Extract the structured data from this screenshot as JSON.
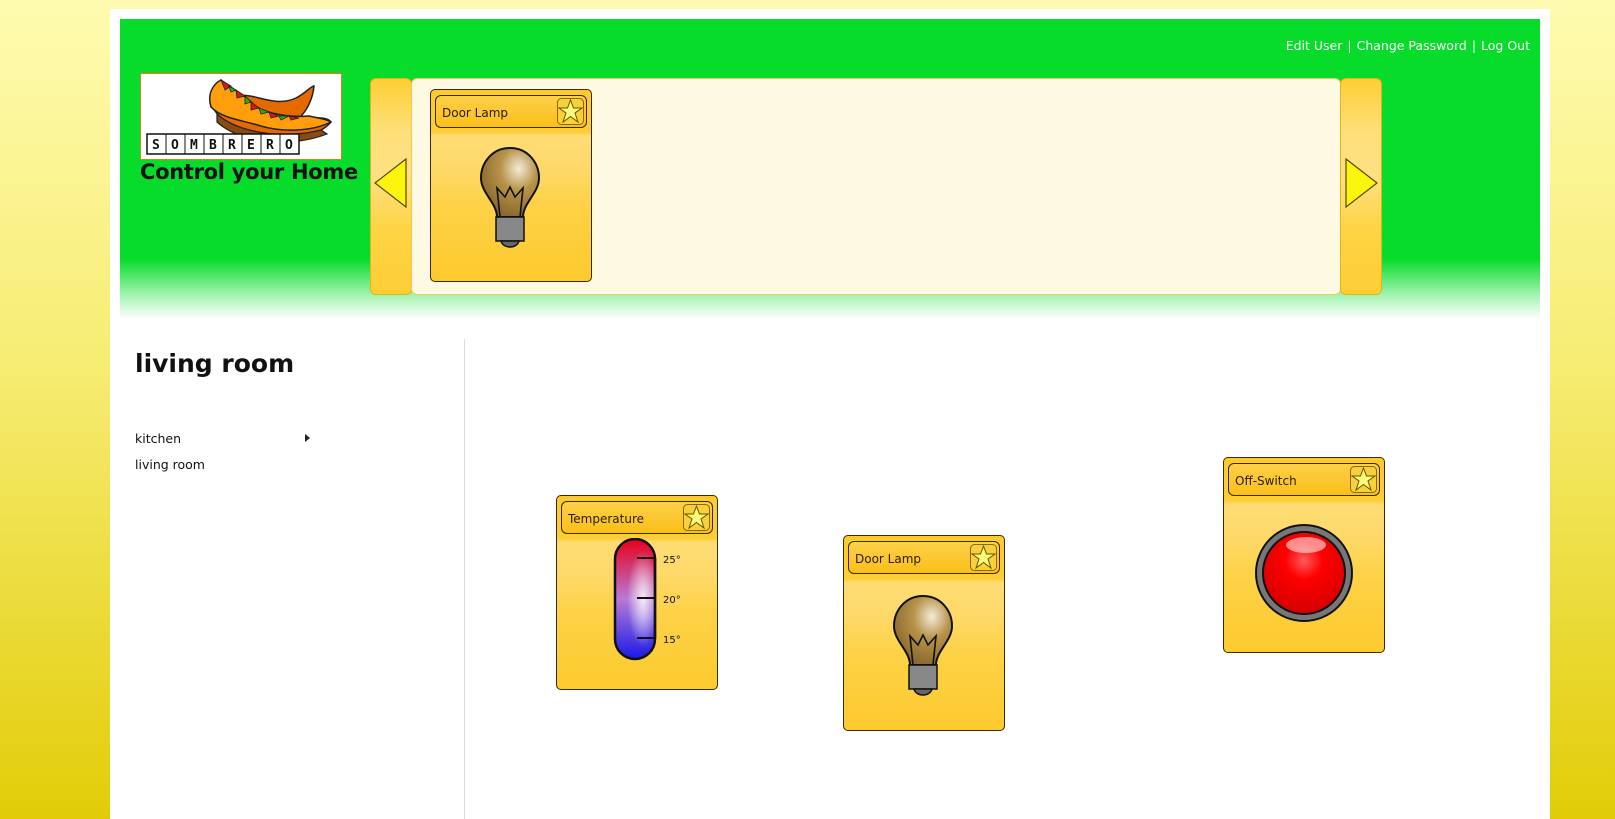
{
  "header": {
    "links": [
      "Edit User",
      "Change Password",
      "Log Out"
    ],
    "logo_text": "SOMBRERO",
    "tagline": "Control your Home"
  },
  "carousel": {
    "items": [
      {
        "title": "Door Lamp",
        "icon": "light-bulb-icon"
      }
    ],
    "left_icon": "arrow-left-icon",
    "right_icon": "arrow-right-icon"
  },
  "sidebar": {
    "room_title": "living room",
    "items": [
      {
        "label": "kitchen",
        "has_submenu": true
      },
      {
        "label": "living room",
        "has_submenu": false
      }
    ]
  },
  "widgets": [
    {
      "title": "Temperature",
      "type": "thermometer",
      "ticks": [
        "25°",
        "20°",
        "15°"
      ]
    },
    {
      "title": "Door Lamp",
      "type": "lamp"
    },
    {
      "title": "Off-Switch",
      "type": "switch"
    }
  ],
  "colors": {
    "header_green": "#07dc2b",
    "widget_yellow": "#fdca2e",
    "switch_red": "#ff0000"
  }
}
